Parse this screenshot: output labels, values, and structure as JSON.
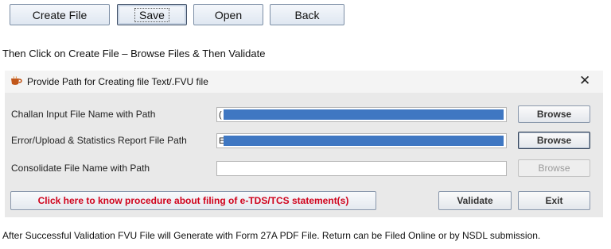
{
  "toolbar": {
    "create_file": "Create File",
    "save": "Save",
    "open": "Open",
    "back": "Back"
  },
  "instruction": "Then Click on Create File – Browse Files & Then Validate",
  "dialog": {
    "title": "Provide Path for Creating file Text/.FVU file",
    "close_glyph": "✕",
    "rows": [
      {
        "label": "Challan Input File Name with Path",
        "value": "(",
        "browse": "Browse"
      },
      {
        "label": "Error/Upload & Statistics Report File Path",
        "value": "E",
        "browse": "Browse"
      },
      {
        "label": "Consolidate File Name with Path",
        "value": "",
        "browse": "Browse"
      }
    ],
    "procedure_link": "Click here to know procedure about filing of e-TDS/TCS statement(s)",
    "validate": "Validate",
    "exit": "Exit"
  },
  "footer": "After Successful Validation FVU File will Generate with Form 27A PDF File. Return can be Filed Online or by NSDL submission."
}
